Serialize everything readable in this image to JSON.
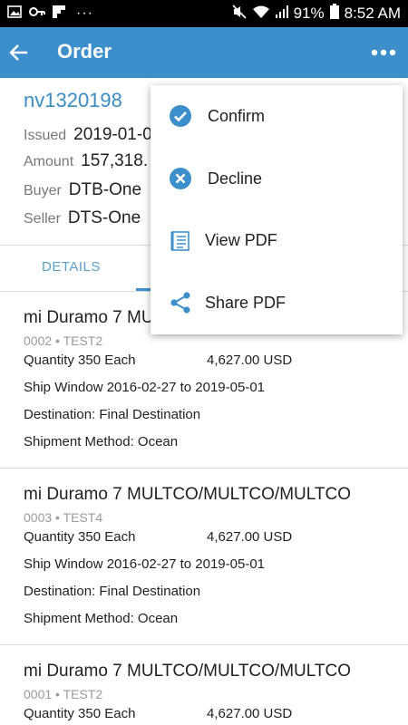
{
  "status_bar": {
    "battery": "91%",
    "time": "8:52 AM",
    "more": "···"
  },
  "app_bar": {
    "title": "Order"
  },
  "order": {
    "id": "nv1320198",
    "issued_label": "Issued",
    "issued_value": "2019-01-0",
    "amount_label": "Amount",
    "amount_value": "157,318.",
    "buyer_label": "Buyer",
    "buyer_value": "DTB-One",
    "seller_label": "Seller",
    "seller_value": "DTS-One"
  },
  "tabs": [
    {
      "label": "DETAILS"
    }
  ],
  "items": [
    {
      "title": "mi Duramo 7 MU",
      "sub": "0002 • TEST2",
      "quantity": "Quantity 350 Each",
      "price": "4,627.00 USD",
      "ship_window": "Ship Window 2016-02-27 to 2019-05-01",
      "destination": "Destination: Final Destination",
      "method": "Shipment Method: Ocean"
    },
    {
      "title": "mi Duramo 7 MULTCO/MULTCO/MULTCO",
      "sub": "0003 • TEST4",
      "quantity": "Quantity 350 Each",
      "price": "4,627.00 USD",
      "ship_window": "Ship Window 2016-02-27 to 2019-05-01",
      "destination": "Destination: Final Destination",
      "method": "Shipment Method: Ocean"
    },
    {
      "title": "mi Duramo 7 MULTCO/MULTCO/MULTCO",
      "sub": "0001 • TEST2",
      "quantity": "Quantity 350 Each",
      "price": "4,627.00 USD"
    }
  ],
  "menu": {
    "items": [
      {
        "label": "Confirm",
        "icon": "check-circle-icon"
      },
      {
        "label": "Decline",
        "icon": "x-circle-icon"
      },
      {
        "label": "View PDF",
        "icon": "document-icon"
      },
      {
        "label": "Share PDF",
        "icon": "share-icon"
      }
    ]
  },
  "colors": {
    "app_bar": "#3d8fcb",
    "accent": "#3a8cc3",
    "status_bar": "#000000"
  }
}
